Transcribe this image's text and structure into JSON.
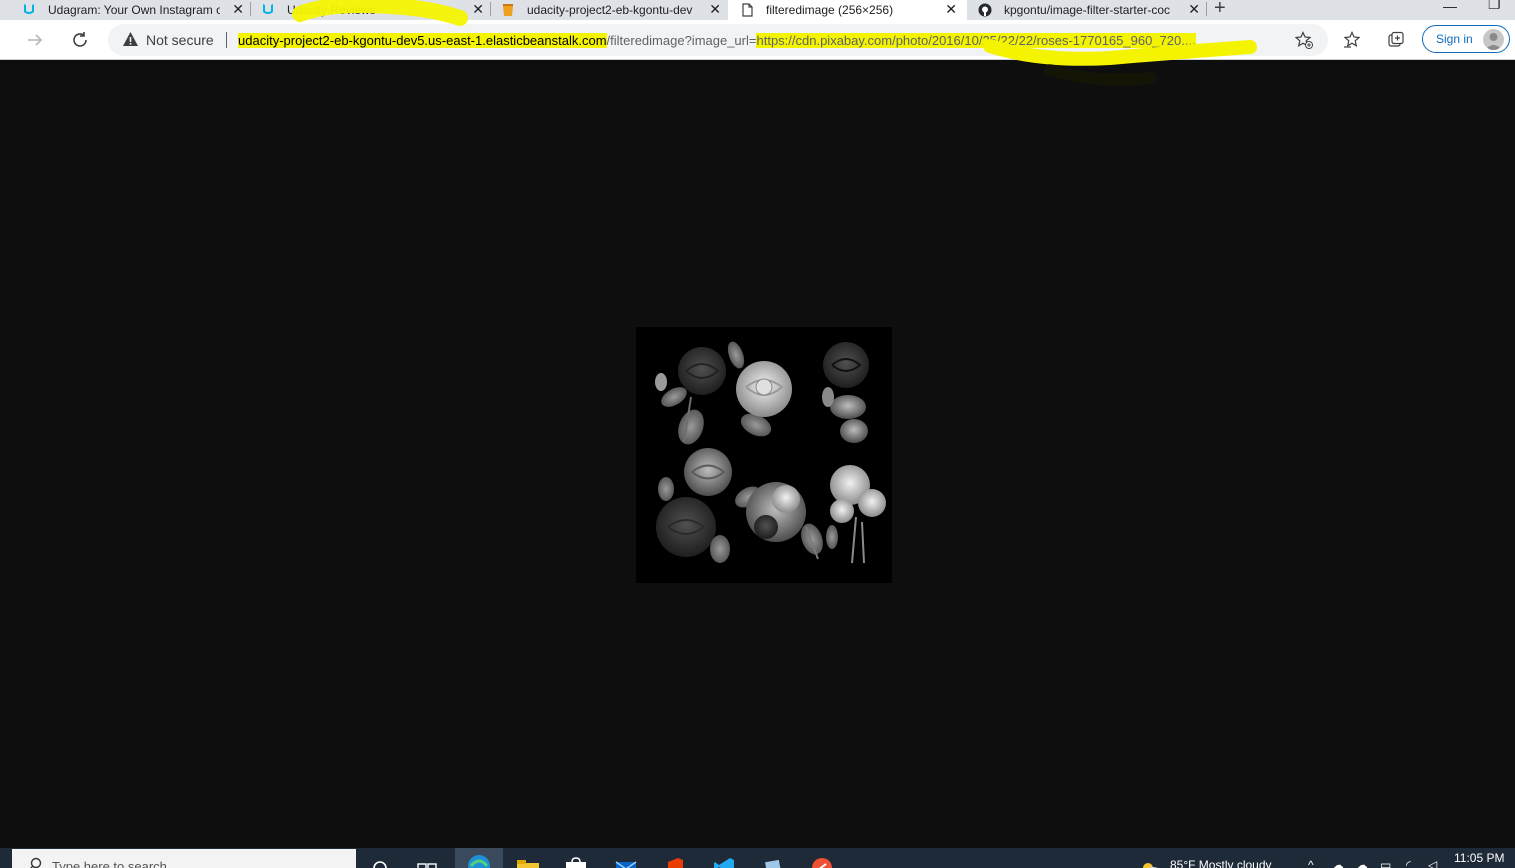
{
  "tabs": [
    {
      "title": "Udagram: Your Own Instagram o",
      "icon": "udacity-logo-icon"
    },
    {
      "title": "Udacity Reviews",
      "icon": "udacity-logo-icon"
    },
    {
      "title": "udacity-project2-eb-kgontu-dev",
      "icon": "aws-bucket-icon"
    },
    {
      "title": "filteredimage (256×256)",
      "icon": "document-icon",
      "active": true
    },
    {
      "title": "kpgontu/image-filter-starter-coc",
      "icon": "github-icon"
    }
  ],
  "tab_close": "✕",
  "new_tab": "+",
  "address": {
    "security": "Not secure",
    "host": "udacity-project2-eb-kgontu-dev5.us-east-1.elasticbeanstalk.com",
    "path_pre": "/filteredimage?image_url=",
    "path_hl": "https://cdn.pixabay.com/photo/2016/10/25/22/22/roses-1770165_960_720...."
  },
  "signin": "Sign in",
  "taskbar": {
    "search_placeholder": "Type here to search",
    "weather": "85°F  Mostly cloudy",
    "time": "11:05 PM"
  },
  "colors": {
    "highlight": "#f4f400",
    "page_bg": "#0e0e0e",
    "signin_accent": "#0f6cbd"
  }
}
